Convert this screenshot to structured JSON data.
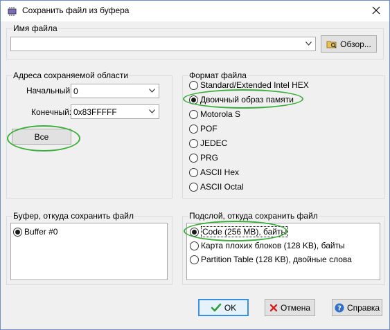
{
  "window": {
    "title": "Сохранить файл из буфера",
    "close_glyph": "✕"
  },
  "filename": {
    "group_label": "Имя файла",
    "value": "",
    "browse_label": "Обзор..."
  },
  "address": {
    "group_label": "Адреса сохраняемой области",
    "start_label": "Начальный:",
    "start_value": "0",
    "end_label": "Конечный:",
    "end_value": "0x83FFFFF",
    "all_button": "Все"
  },
  "format": {
    "group_label": "Формат файла",
    "options": [
      {
        "label": "Standard/Extended Intel HEX",
        "checked": false
      },
      {
        "label": "Двоичный образ памяти",
        "checked": true
      },
      {
        "label": "Motorola S",
        "checked": false
      },
      {
        "label": "POF",
        "checked": false
      },
      {
        "label": "JEDEC",
        "checked": false
      },
      {
        "label": "PRG",
        "checked": false
      },
      {
        "label": "ASCII Hex",
        "checked": false
      },
      {
        "label": "ASCII Octal",
        "checked": false
      }
    ]
  },
  "buffer": {
    "group_label": "Буфер, откуда сохранить файл",
    "items": [
      {
        "label": "Buffer #0",
        "checked": true
      }
    ]
  },
  "sublayer": {
    "group_label": "Подслой, откуда сохранить файл",
    "options": [
      {
        "label": "Code (256 MB), байты",
        "checked": true
      },
      {
        "label": "Карта плохих блоков (128 KB), байты",
        "checked": false
      },
      {
        "label": "Partition Table (128 KB), двойные слова",
        "checked": false
      }
    ]
  },
  "buttons": {
    "ok": "OK",
    "cancel": "Отмена",
    "help": "Справка"
  },
  "colors": {
    "highlight": "#3cae3c",
    "accent": "#3b8ede"
  }
}
